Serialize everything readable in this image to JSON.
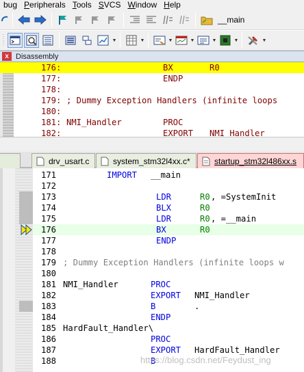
{
  "menu": [
    "bug",
    "Peripherals",
    "Tools",
    "SVCS",
    "Window",
    "Help"
  ],
  "menu_underline": [
    "",
    "P",
    "T",
    "S",
    "W",
    "H"
  ],
  "target_name": "__main",
  "disassembly": {
    "title": "Disassembly",
    "close_label": "x",
    "lines": [
      {
        "num": "176:",
        "op": "BX",
        "arg": "R0",
        "highlight": true
      },
      {
        "num": "177:",
        "op": "ENDP",
        "arg": "",
        "highlight": false
      },
      {
        "num": "178:",
        "op": "",
        "arg": "",
        "highlight": false
      },
      {
        "num": "179:",
        "text": "; Dummy Exception Handlers (infinite loops",
        "highlight": false
      },
      {
        "num": "180:",
        "op": "",
        "arg": "",
        "highlight": false
      },
      {
        "num": "181:",
        "label": "NMI_Handler",
        "op": "PROC",
        "highlight": false
      },
      {
        "num": "182:",
        "op": "EXPORT",
        "arg": "NMI_Handler",
        "highlight": false
      }
    ]
  },
  "tabs": [
    {
      "label": "drv_usart.c",
      "active": false
    },
    {
      "label": "system_stm32l4xx.c*",
      "active": false
    },
    {
      "label": "startup_stm32l486xx.s",
      "active": true
    }
  ],
  "editor_lines": [
    {
      "num": "171",
      "parts": [
        [
          "IMPORT",
          "kw",
          64
        ],
        [
          "__main",
          "plain",
          128
        ]
      ]
    },
    {
      "num": "172",
      "parts": []
    },
    {
      "num": "173",
      "parts": [
        [
          "LDR",
          "kw",
          136
        ],
        [
          "R0",
          "reg",
          200
        ],
        [
          ", =SystemInit",
          "plain",
          216
        ]
      ]
    },
    {
      "num": "174",
      "parts": [
        [
          "BLX",
          "kw",
          136
        ],
        [
          "R0",
          "reg",
          200
        ]
      ]
    },
    {
      "num": "175",
      "parts": [
        [
          "LDR",
          "kw",
          136
        ],
        [
          "R0",
          "reg",
          200
        ],
        [
          ", =__main",
          "plain",
          216
        ]
      ]
    },
    {
      "num": "176",
      "parts": [
        [
          "BX",
          "kw",
          136
        ],
        [
          "R0",
          "reg",
          200
        ]
      ],
      "current": true
    },
    {
      "num": "177",
      "parts": [
        [
          "ENDP",
          "kw",
          136
        ]
      ]
    },
    {
      "num": "178",
      "parts": []
    },
    {
      "num": "179",
      "parts": [
        [
          "; Dummy Exception Handlers (infinite loops w",
          "cmt",
          0
        ]
      ]
    },
    {
      "num": "180",
      "parts": []
    },
    {
      "num": "181",
      "parts": [
        [
          "NMI_Handler",
          "plain",
          0
        ],
        [
          "PROC",
          "kw",
          128
        ]
      ]
    },
    {
      "num": "182",
      "parts": [
        [
          "EXPORT",
          "kw",
          128
        ],
        [
          "NMI_Handler",
          "plain",
          192
        ]
      ]
    },
    {
      "num": "183",
      "parts": [
        [
          "B",
          "kw",
          128
        ],
        [
          ".",
          "plain",
          192
        ]
      ]
    },
    {
      "num": "184",
      "parts": [
        [
          "ENDP",
          "kw",
          128
        ]
      ]
    },
    {
      "num": "185",
      "parts": [
        [
          "HardFault_Handler\\",
          "plain",
          0
        ]
      ]
    },
    {
      "num": "186",
      "parts": [
        [
          "PROC",
          "kw",
          128
        ]
      ]
    },
    {
      "num": "187",
      "parts": [
        [
          "EXPORT",
          "kw",
          128
        ],
        [
          "HardFault_Handler",
          "plain",
          192
        ]
      ]
    },
    {
      "num": "188",
      "parts": [
        [
          "B",
          "kw",
          128
        ]
      ]
    }
  ],
  "watermark": "https://blog.csdn.net/Feydust_ing"
}
